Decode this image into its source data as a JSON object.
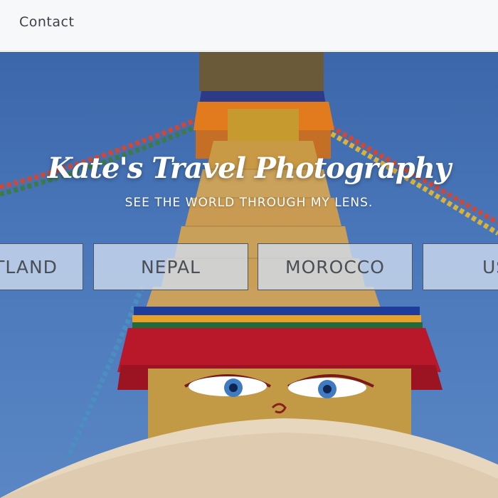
{
  "nav": {
    "contact_label": "Contact"
  },
  "hero": {
    "title": "Kate's Travel Photography",
    "subtitle": "SEE THE WORLD THROUGH MY LENS."
  },
  "destinations": [
    {
      "label": "SCOTLAND"
    },
    {
      "label": "NEPAL"
    },
    {
      "label": "MOROCCO"
    },
    {
      "label": "USA"
    }
  ],
  "colors": {
    "sky": "#4a78ba",
    "nav_bg": "#f7f8f9",
    "card_bg": "#d2def0",
    "card_text": "#4a4f57"
  }
}
